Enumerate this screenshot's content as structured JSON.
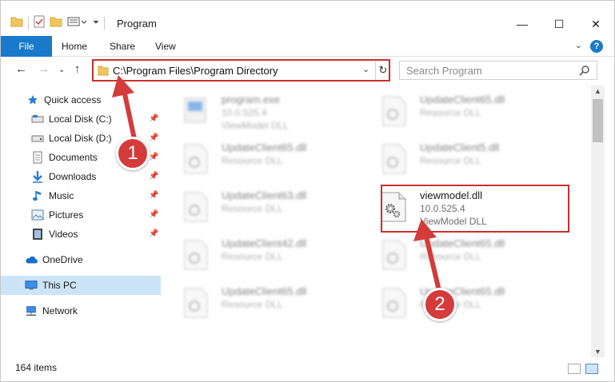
{
  "window": {
    "title": "Program",
    "controls": {
      "minimize": "—",
      "maximize": "☐",
      "close": "✕"
    }
  },
  "ribbon": {
    "tabs": [
      "File",
      "Home",
      "Share",
      "View"
    ],
    "help": "?"
  },
  "navigation": {
    "address_path": "C:\\Program Files\\Program Directory",
    "search_placeholder": "Search Program"
  },
  "sidebar": {
    "items": [
      {
        "label": "Quick access",
        "icon": "star-icon",
        "pinned": false
      },
      {
        "label": "Local Disk (C:)",
        "icon": "drive-icon",
        "pinned": true
      },
      {
        "label": "Local Disk (D:)",
        "icon": "drive-icon",
        "pinned": true
      },
      {
        "label": "Documents",
        "icon": "documents-icon",
        "pinned": true
      },
      {
        "label": "Downloads",
        "icon": "download-icon",
        "pinned": true
      },
      {
        "label": "Music",
        "icon": "music-icon",
        "pinned": true
      },
      {
        "label": "Pictures",
        "icon": "pictures-icon",
        "pinned": true
      },
      {
        "label": "Videos",
        "icon": "videos-icon",
        "pinned": true
      },
      {
        "label": "OneDrive",
        "icon": "cloud-icon",
        "pinned": false
      },
      {
        "label": "This PC",
        "icon": "computer-icon",
        "pinned": false,
        "selected": true
      },
      {
        "label": "Network",
        "icon": "network-icon",
        "pinned": false
      }
    ]
  },
  "files": [
    {
      "name": "program.exe",
      "version": "10.0.525.4",
      "description": "ViewModel DLL",
      "blurred": true
    },
    {
      "name": "UpdateClient65.dll",
      "version": "",
      "description": "Resource DLL",
      "blurred": true
    },
    {
      "name": "UpdateClient65.dll",
      "version": "",
      "description": "Resource DLL",
      "blurred": true
    },
    {
      "name": "UpdateClient5.dll",
      "version": "",
      "description": "Resource DLL",
      "blurred": true
    },
    {
      "name": "UpdateClient63.dll",
      "version": "",
      "description": "Resource DLL",
      "blurred": true
    },
    {
      "name": "viewmodel.dll",
      "version": "10.0.525.4",
      "description": "ViewModel DLL",
      "blurred": false,
      "highlighted": true
    },
    {
      "name": "UpdateClient42.dll",
      "version": "",
      "description": "Resource DLL",
      "blurred": true
    },
    {
      "name": "UpdateClient65.dll",
      "version": "",
      "description": "Resource DLL",
      "blurred": true
    },
    {
      "name": "UpdateClient65.dll",
      "version": "",
      "description": "Resource DLL",
      "blurred": true
    },
    {
      "name": "UpdateClient65.dll",
      "version": "",
      "description": "Resource DLL",
      "blurred": true
    }
  ],
  "status": {
    "item_count": "164 items"
  },
  "annotations": {
    "step1": "1",
    "step2": "2",
    "color": "#d43b3b"
  }
}
